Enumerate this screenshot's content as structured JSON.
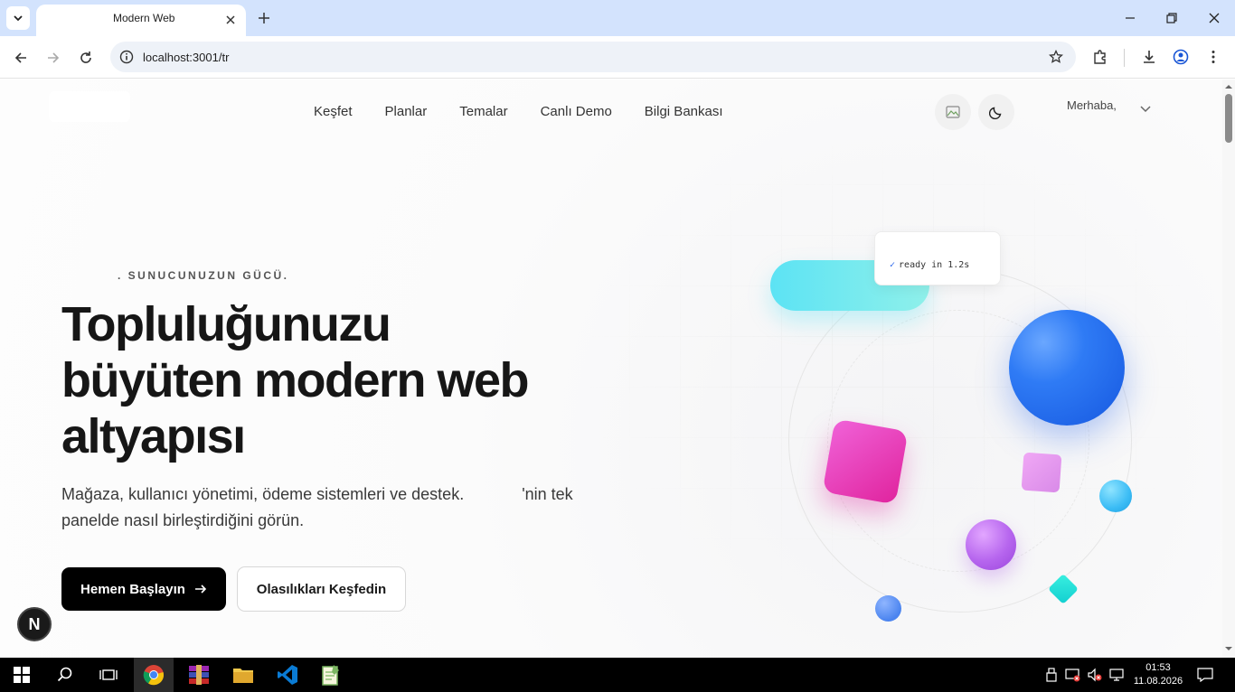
{
  "browser": {
    "tab_title": "Modern Web",
    "url": "localhost:3001/tr"
  },
  "site": {
    "nav": [
      "Keşfet",
      "Planlar",
      "Temalar",
      "Canlı Demo",
      "Bilgi Bankası"
    ],
    "greeting": "Merhaba,"
  },
  "hero": {
    "eyebrow": ". SUNUCUNUZUN GÜCÜ.",
    "headline": "Topluluğunuzu büyüten modern web altyapısı",
    "subtext_part1": "Mağaza, kullanıcı yönetimi, ödeme sistemleri ve destek.",
    "subtext_part2": "'nin tek panelde nasıl birleştirdiğini görün.",
    "primary_cta": "Hemen Başlayın",
    "secondary_cta": "Olasılıkları Keşfedin"
  },
  "illustration": {
    "status_text": "ready in 1.2s",
    "status_check": "✓"
  },
  "badge": {
    "letter": "N"
  },
  "taskbar": {
    "time": "01:53",
    "date": "11.08.2026"
  },
  "colors": {
    "primary_button": "#000000",
    "accent_blue": "#2f7bf5",
    "accent_pink": "#e0249e",
    "accent_cyan": "#5ce3f4",
    "tabbar": "#d3e3fd"
  },
  "icons": [
    "tab-list-icon",
    "close-icon",
    "plus-icon",
    "minimize-icon",
    "restore-icon",
    "back-icon",
    "forward-icon",
    "reload-icon",
    "info-icon",
    "star-icon",
    "extensions-icon",
    "download-icon",
    "profile-icon",
    "menu-icon",
    "moon-icon",
    "chevron-down-icon",
    "arrow-right-icon",
    "windows-icon",
    "search-icon",
    "task-view-icon",
    "chrome-icon",
    "winrar-icon",
    "folder-icon",
    "vscode-icon",
    "notepad-icon"
  ]
}
